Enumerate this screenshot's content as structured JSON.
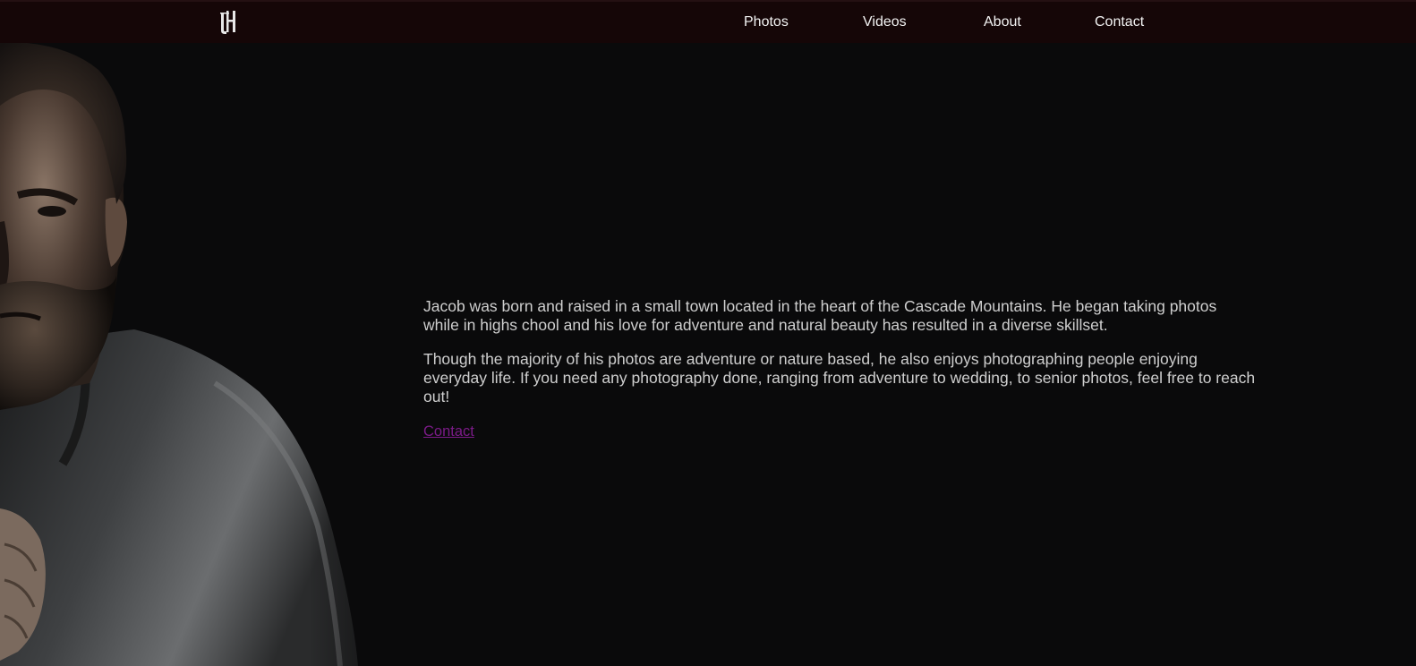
{
  "brand": {
    "logo_text": "JH"
  },
  "nav": {
    "items": [
      {
        "id": "photos",
        "label": "Photos"
      },
      {
        "id": "videos",
        "label": "Videos"
      },
      {
        "id": "about",
        "label": "About"
      },
      {
        "id": "contact",
        "label": "Contact"
      }
    ]
  },
  "portrait": {
    "subject": "bearded man in grey t-shirt, low-key lighting"
  },
  "bio": {
    "paragraph_1": "Jacob was born and raised in a small town located in the heart of the Cascade Mountains. He began taking photos while in highs chool and his love for adventure and natural beauty has resulted in a diverse skillset.",
    "paragraph_2": "Though the majority of his photos are adventure or nature based, he also enjoys photographing people enjoying everyday life. If you need any photography done, ranging from adventure to wedding, to senior photos, feel free to reach out!",
    "contact_link": "Contact"
  },
  "colors": {
    "page_background": "#0a0a0b",
    "navbar_background": "#150607",
    "nav_text": "#f2f2f2",
    "body_text": "#cfcfcf",
    "link_color": "#7b1b88"
  }
}
